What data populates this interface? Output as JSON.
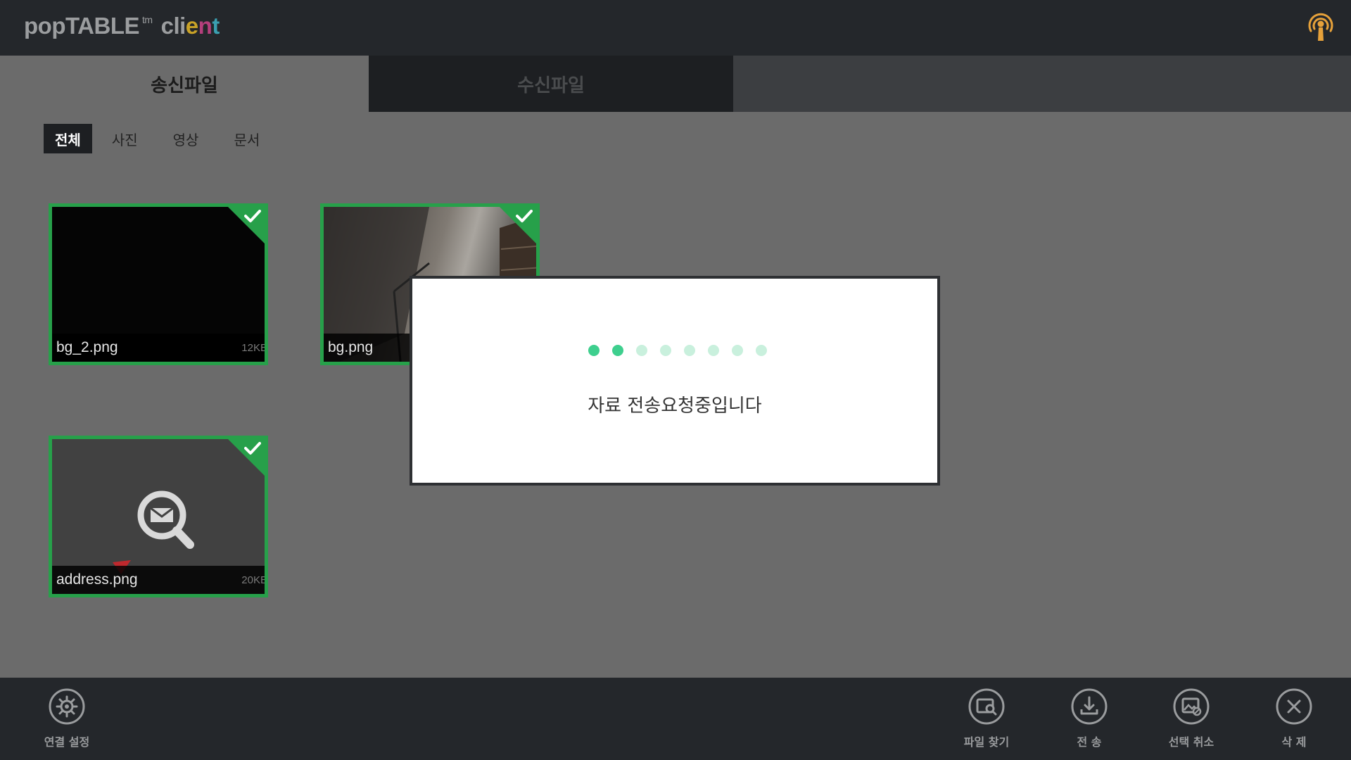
{
  "header": {
    "logo_main": "popTABLE",
    "logo_tm": "tm",
    "logo_client_letters": [
      {
        "ch": "c",
        "color": "#9b9d9f"
      },
      {
        "ch": "l",
        "color": "#9b9d9f"
      },
      {
        "ch": "i",
        "color": "#9b9d9f"
      },
      {
        "ch": "e",
        "color": "#c9a227"
      },
      {
        "ch": "n",
        "color": "#b43f7c"
      },
      {
        "ch": "t",
        "color": "#3a9fb0"
      }
    ],
    "signal_icon": "broadcast-icon",
    "signal_color": "#e6a13a"
  },
  "tabs": {
    "send_label": "송신파일",
    "receive_label": "수신파일"
  },
  "filters": [
    {
      "label": "전체",
      "active": true
    },
    {
      "label": "사진",
      "active": false
    },
    {
      "label": "영상",
      "active": false
    },
    {
      "label": "문서",
      "active": false
    }
  ],
  "files": [
    {
      "name": "bg_2.png",
      "size": "12KB",
      "selected": true
    },
    {
      "name": "bg.png",
      "size": "",
      "selected": true
    },
    {
      "name": "address.png",
      "size": "20KB",
      "selected": true
    }
  ],
  "modal": {
    "message": "자료 전송요청중입니다",
    "dot_count": 8,
    "dot_active_color": "#3ecf8e",
    "dot_inactive_color": "#c9f0dd",
    "active_dots": 2
  },
  "toolbar": {
    "connect_label": "연결 설정",
    "find_label": "파일 찾기",
    "send_label": "전 송",
    "deselect_label": "선택 취소",
    "delete_label": "삭 제"
  },
  "colors": {
    "accent_green": "#27a04a",
    "header_bg": "#24272b",
    "content_bg": "#6b6b6b"
  }
}
